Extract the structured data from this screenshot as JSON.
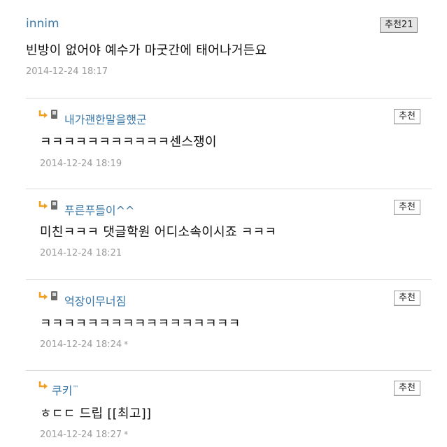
{
  "comments": [
    {
      "nick": "innim",
      "text": "빈방이 없어야 예수가 마굿간에 태어나거든요",
      "date": "2014-12-24 18:17",
      "rec": "추천21",
      "is_reply": false,
      "mobile": false,
      "starred": false
    },
    {
      "nick": "내가괜한말을했군",
      "text": "ㅋㅋㅋㅋㅋㅋㅋㅋㅋㅋㅋ센스쟁이",
      "date": "2014-12-24 18:19",
      "rec": "추천",
      "is_reply": true,
      "mobile": true,
      "starred": false
    },
    {
      "nick": "푸른푸들이^^",
      "text": "미친ㅋㅋㅋ 댓글학원 어디소속이시죠 ㅋㅋㅋ",
      "date": "2014-12-24 18:21",
      "rec": "추천",
      "is_reply": true,
      "mobile": true,
      "starred": false
    },
    {
      "nick": "억장이무너짐",
      "text": "ㅋㅋㅋㅋㅋㅋㅋㅋㅋㅋㅋㅋㅋㅋㅋㅋㅋ",
      "date": "2014-12-24 18:24",
      "rec": "추천",
      "is_reply": true,
      "mobile": true,
      "starred": true
    },
    {
      "nick": "쿠키",
      "nick_suffix": "™",
      "text": "ㅎㄷㄷ 드립 [[최고]]",
      "date": "2014-12-24 18:27",
      "rec": "추천",
      "is_reply": true,
      "mobile": false,
      "starred": true
    }
  ],
  "star_glyph": "*",
  "colors": {
    "nick": "#3a78a8",
    "date": "#9a9a9a",
    "divider": "#d9d9d9",
    "reply_arrow": "#f0a020"
  }
}
